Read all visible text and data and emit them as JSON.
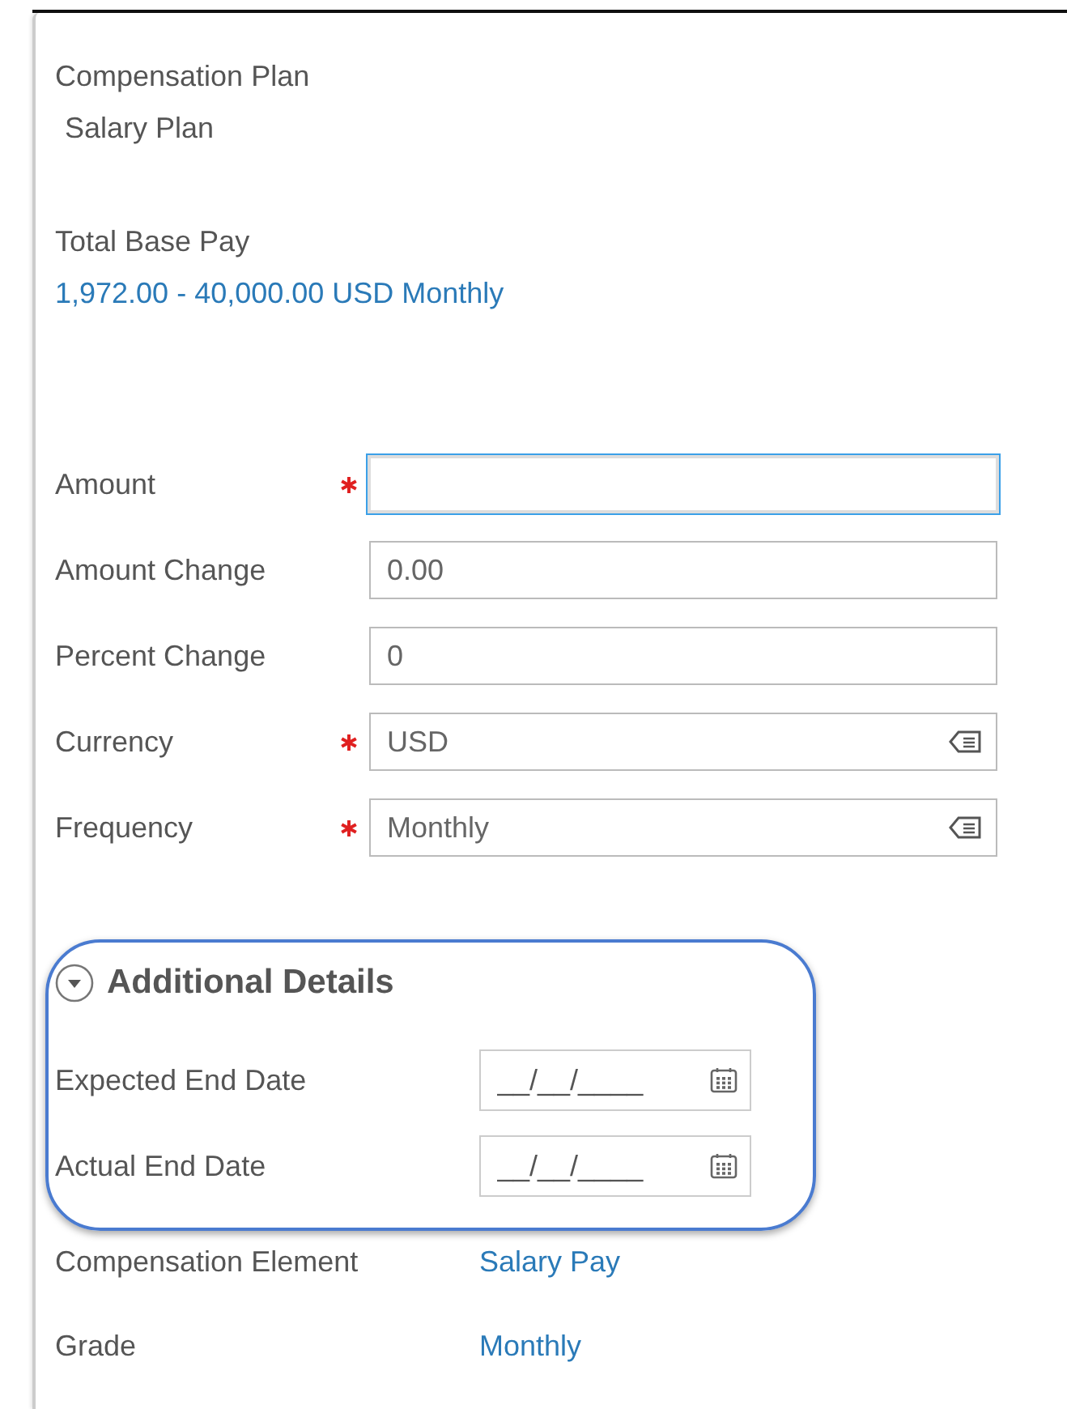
{
  "summary": [
    {
      "label": "Compensation Plan",
      "value": "Salary Plan",
      "kind": "plain"
    },
    {
      "label": "Total Base Pay",
      "value": "1,972.00 - 40,000.00 USD Monthly",
      "kind": "link"
    }
  ],
  "fields": [
    {
      "label": "Amount",
      "required": true,
      "focused": true,
      "kind": "text"
    },
    {
      "label": "Amount Change",
      "required": false,
      "focused": false,
      "kind": "text",
      "value": "0.00"
    },
    {
      "label": "Percent Change",
      "required": false,
      "focused": false,
      "kind": "text",
      "value": "0"
    },
    {
      "label": "Currency",
      "required": true,
      "focused": false,
      "kind": "select",
      "value": "USD"
    },
    {
      "label": "Frequency",
      "required": true,
      "focused": false,
      "kind": "select",
      "value": "Monthly"
    }
  ],
  "additional_details": {
    "title": "Additional Details",
    "expanded": true,
    "highlighted": true,
    "fields": [
      {
        "label": "Expected End Date",
        "placeholder": "__/__/____"
      },
      {
        "label": "Actual End Date",
        "placeholder": "__/__/____"
      }
    ]
  },
  "details": [
    {
      "label": "Compensation Element",
      "value": "Salary Pay"
    },
    {
      "label": "Grade",
      "value": "Monthly"
    }
  ]
}
